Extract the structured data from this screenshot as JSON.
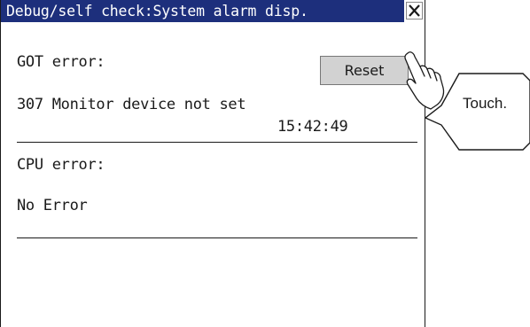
{
  "window": {
    "title": "Debug/self check:System alarm disp.",
    "close_icon": "close-icon"
  },
  "got_section": {
    "label": "GOT error:",
    "reset_label": "Reset",
    "message": "307 Monitor device not set",
    "time": "15:42:49"
  },
  "cpu_section": {
    "label": "CPU error:",
    "message": "No Error"
  },
  "callout": {
    "text": "Touch.",
    "icon": "hand-pointer-icon"
  },
  "colors": {
    "titlebar": "#1d2f7c",
    "reset_button": "#d2d2d2"
  }
}
